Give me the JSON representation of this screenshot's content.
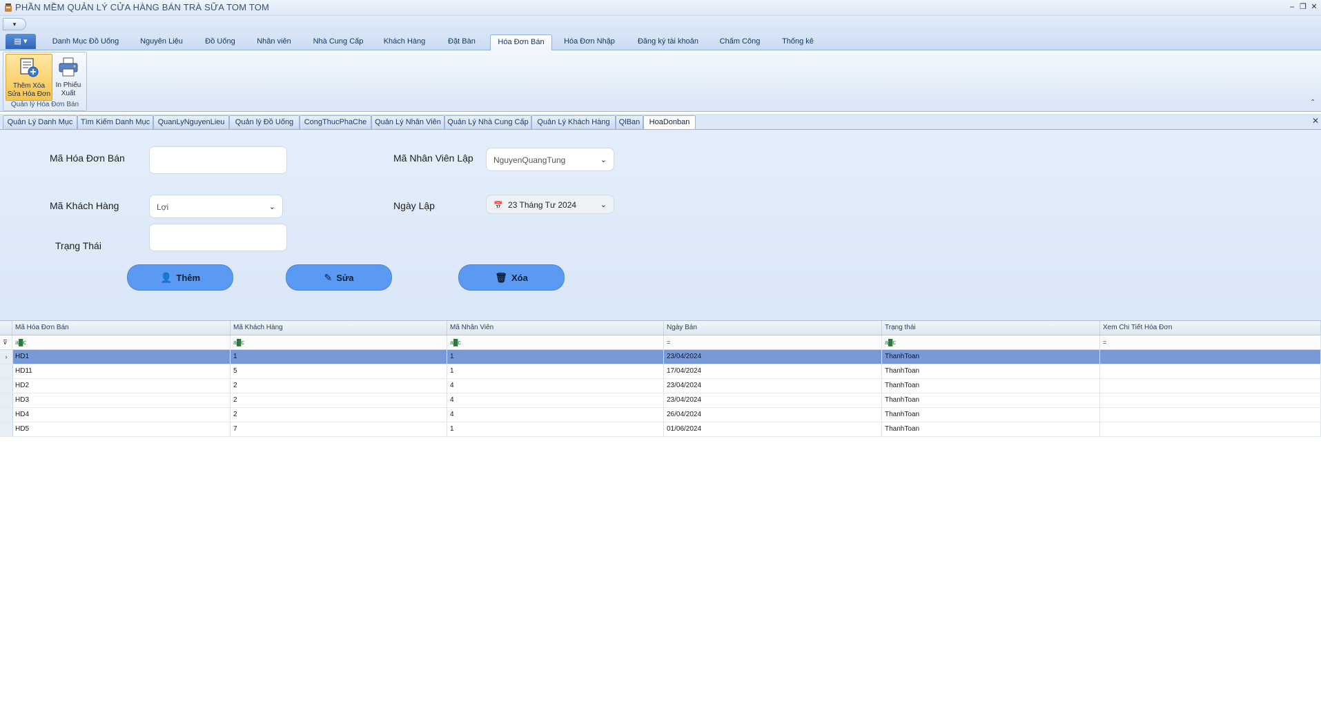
{
  "window": {
    "title": "PHẦN MỀM QUẢN LÝ CỬA HÀNG BÁN TRÀ SỮA TOM TOM",
    "controls": [
      "–",
      "❐",
      "✕"
    ]
  },
  "quick_access": {
    "label": "▾"
  },
  "ribbon": {
    "app_button": "▤ ▾",
    "tabs": [
      "Danh Mục Đồ Uống",
      "Nguyên Liệu",
      "Đồ Uống",
      "Nhân viên",
      "Nhà Cung Cấp",
      "Khách Hàng",
      "Đặt Bàn",
      "Hóa Đơn Bán",
      "Hóa Đơn Nhập",
      "Đăng ký tài khoản",
      "Chấm Công",
      "Thống kê"
    ],
    "active_tab": "Hóa Đơn Bán",
    "group": {
      "label": "Quản lý Hóa Đơn Bán",
      "button_add": "Thêm Xóa Sửa Hóa Đơn",
      "button_print": "In Phiếu Xuất"
    },
    "collapse": "⌃"
  },
  "doc_tabs": {
    "items": [
      "Quản Lý Danh Mục",
      "Tìm Kiếm Danh Mục",
      "QuanLyNguyenLieu",
      "Quản lý Đồ Uống",
      "CongThucPhaChe",
      "Quản Lý Nhân Viên",
      "Quản Lý Nhà Cung Cấp",
      "Quản Lý Khách Hàng",
      "QlBan",
      "HoaDonban"
    ],
    "active": "HoaDonban",
    "close": "✕"
  },
  "form": {
    "ma_hoa_don_ban": {
      "label": "Mã Hóa Đơn Bán",
      "value": ""
    },
    "ma_nhan_vien_lap": {
      "label": "Mã Nhân Viên Lập",
      "value": "NguyenQuangTung"
    },
    "ma_khach_hang": {
      "label": "Mã Khách Hàng",
      "value": "Lợi"
    },
    "ngay_lap": {
      "label": "Ngày Lập",
      "value": "23 Tháng Tư 2024"
    },
    "trang_thai": {
      "label": "Trạng Thái",
      "value": ""
    },
    "buttons": {
      "them": "Thêm",
      "sua": "Sửa",
      "xoa": "Xóa"
    }
  },
  "grid": {
    "columns": [
      "Mã Hóa Đơn Bán",
      "Mã Khách Hàng",
      "Mã Nhân Viên",
      "Ngày Bán",
      "Trạng thái",
      "Xem Chi Tiết Hóa Đơn"
    ],
    "filter_icons": [
      "a█c",
      "a█c",
      "a█c",
      "=",
      "a█c",
      "="
    ],
    "rows": [
      [
        "HD1",
        "1",
        "1",
        "23/04/2024",
        "ThanhToan",
        ""
      ],
      [
        "HD11",
        "5",
        "1",
        "17/04/2024",
        "ThanhToan",
        ""
      ],
      [
        "HD2",
        "2",
        "4",
        "23/04/2024",
        "ThanhToan",
        ""
      ],
      [
        "HD3",
        "2",
        "4",
        "23/04/2024",
        "ThanhToan",
        ""
      ],
      [
        "HD4",
        "2",
        "4",
        "26/04/2024",
        "ThanhToan",
        ""
      ],
      [
        "HD5",
        "7",
        "1",
        "01/06/2024",
        "ThanhToan",
        ""
      ]
    ],
    "selected_row": 0,
    "row_indicator": "›",
    "filter_row_icon": "⊽"
  },
  "colors": {
    "accent": "#5a9af3",
    "selection": "#7899d8",
    "form_bg": "#dce8f7",
    "ribbon_active": "#f7c34c"
  },
  "icons": {
    "app": "app-icon",
    "add_invoice": "invoice-edit-icon",
    "print": "printer-icon",
    "calendar": "calendar-icon",
    "btn_add": "user-add-icon",
    "btn_edit": "pencil-icon",
    "btn_delete": "trash-icon"
  }
}
